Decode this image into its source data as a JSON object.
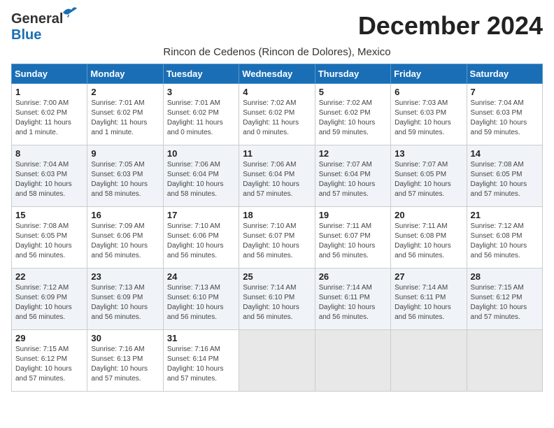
{
  "logo": {
    "general": "General",
    "blue": "Blue"
  },
  "title": "December 2024",
  "subtitle": "Rincon de Cedenos (Rincon de Dolores), Mexico",
  "days_header": [
    "Sunday",
    "Monday",
    "Tuesday",
    "Wednesday",
    "Thursday",
    "Friday",
    "Saturday"
  ],
  "weeks": [
    [
      {
        "day": "1",
        "info": "Sunrise: 7:00 AM\nSunset: 6:02 PM\nDaylight: 11 hours\nand 1 minute."
      },
      {
        "day": "2",
        "info": "Sunrise: 7:01 AM\nSunset: 6:02 PM\nDaylight: 11 hours\nand 1 minute."
      },
      {
        "day": "3",
        "info": "Sunrise: 7:01 AM\nSunset: 6:02 PM\nDaylight: 11 hours\nand 0 minutes."
      },
      {
        "day": "4",
        "info": "Sunrise: 7:02 AM\nSunset: 6:02 PM\nDaylight: 11 hours\nand 0 minutes."
      },
      {
        "day": "5",
        "info": "Sunrise: 7:02 AM\nSunset: 6:02 PM\nDaylight: 10 hours\nand 59 minutes."
      },
      {
        "day": "6",
        "info": "Sunrise: 7:03 AM\nSunset: 6:03 PM\nDaylight: 10 hours\nand 59 minutes."
      },
      {
        "day": "7",
        "info": "Sunrise: 7:04 AM\nSunset: 6:03 PM\nDaylight: 10 hours\nand 59 minutes."
      }
    ],
    [
      {
        "day": "8",
        "info": "Sunrise: 7:04 AM\nSunset: 6:03 PM\nDaylight: 10 hours\nand 58 minutes."
      },
      {
        "day": "9",
        "info": "Sunrise: 7:05 AM\nSunset: 6:03 PM\nDaylight: 10 hours\nand 58 minutes."
      },
      {
        "day": "10",
        "info": "Sunrise: 7:06 AM\nSunset: 6:04 PM\nDaylight: 10 hours\nand 58 minutes."
      },
      {
        "day": "11",
        "info": "Sunrise: 7:06 AM\nSunset: 6:04 PM\nDaylight: 10 hours\nand 57 minutes."
      },
      {
        "day": "12",
        "info": "Sunrise: 7:07 AM\nSunset: 6:04 PM\nDaylight: 10 hours\nand 57 minutes."
      },
      {
        "day": "13",
        "info": "Sunrise: 7:07 AM\nSunset: 6:05 PM\nDaylight: 10 hours\nand 57 minutes."
      },
      {
        "day": "14",
        "info": "Sunrise: 7:08 AM\nSunset: 6:05 PM\nDaylight: 10 hours\nand 57 minutes."
      }
    ],
    [
      {
        "day": "15",
        "info": "Sunrise: 7:08 AM\nSunset: 6:05 PM\nDaylight: 10 hours\nand 56 minutes."
      },
      {
        "day": "16",
        "info": "Sunrise: 7:09 AM\nSunset: 6:06 PM\nDaylight: 10 hours\nand 56 minutes."
      },
      {
        "day": "17",
        "info": "Sunrise: 7:10 AM\nSunset: 6:06 PM\nDaylight: 10 hours\nand 56 minutes."
      },
      {
        "day": "18",
        "info": "Sunrise: 7:10 AM\nSunset: 6:07 PM\nDaylight: 10 hours\nand 56 minutes."
      },
      {
        "day": "19",
        "info": "Sunrise: 7:11 AM\nSunset: 6:07 PM\nDaylight: 10 hours\nand 56 minutes."
      },
      {
        "day": "20",
        "info": "Sunrise: 7:11 AM\nSunset: 6:08 PM\nDaylight: 10 hours\nand 56 minutes."
      },
      {
        "day": "21",
        "info": "Sunrise: 7:12 AM\nSunset: 6:08 PM\nDaylight: 10 hours\nand 56 minutes."
      }
    ],
    [
      {
        "day": "22",
        "info": "Sunrise: 7:12 AM\nSunset: 6:09 PM\nDaylight: 10 hours\nand 56 minutes."
      },
      {
        "day": "23",
        "info": "Sunrise: 7:13 AM\nSunset: 6:09 PM\nDaylight: 10 hours\nand 56 minutes."
      },
      {
        "day": "24",
        "info": "Sunrise: 7:13 AM\nSunset: 6:10 PM\nDaylight: 10 hours\nand 56 minutes."
      },
      {
        "day": "25",
        "info": "Sunrise: 7:14 AM\nSunset: 6:10 PM\nDaylight: 10 hours\nand 56 minutes."
      },
      {
        "day": "26",
        "info": "Sunrise: 7:14 AM\nSunset: 6:11 PM\nDaylight: 10 hours\nand 56 minutes."
      },
      {
        "day": "27",
        "info": "Sunrise: 7:14 AM\nSunset: 6:11 PM\nDaylight: 10 hours\nand 56 minutes."
      },
      {
        "day": "28",
        "info": "Sunrise: 7:15 AM\nSunset: 6:12 PM\nDaylight: 10 hours\nand 57 minutes."
      }
    ],
    [
      {
        "day": "29",
        "info": "Sunrise: 7:15 AM\nSunset: 6:12 PM\nDaylight: 10 hours\nand 57 minutes."
      },
      {
        "day": "30",
        "info": "Sunrise: 7:16 AM\nSunset: 6:13 PM\nDaylight: 10 hours\nand 57 minutes."
      },
      {
        "day": "31",
        "info": "Sunrise: 7:16 AM\nSunset: 6:14 PM\nDaylight: 10 hours\nand 57 minutes."
      },
      {
        "day": "",
        "info": ""
      },
      {
        "day": "",
        "info": ""
      },
      {
        "day": "",
        "info": ""
      },
      {
        "day": "",
        "info": ""
      }
    ]
  ]
}
